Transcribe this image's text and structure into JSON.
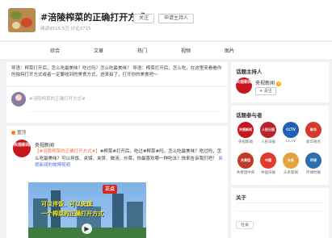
{
  "header": {
    "title": "#涪陵榨菜的正确打开方式#",
    "follow_button": "关注",
    "host_apply_button": "申请主持人",
    "stats": "阅读9515.5万  讨论3715"
  },
  "tabs": [
    {
      "label": "综合"
    },
    {
      "label": "文章"
    },
    {
      "label": "热门"
    },
    {
      "label": "视频"
    },
    {
      "label": "图片"
    }
  ],
  "intro": {
    "text": "导语：榨菜打开后，怎么吃最美味？吃过吗？怎么吃最美味？   导语：榨菜打开后，怎么吃，在这里来看看你的独特打开方式或者一定要收到的美食方式，进来拍了，打开你的美食吧～"
  },
  "composer": {
    "placeholder": "#涪陵榨菜的正确打开方式#"
  },
  "feed": {
    "label": "置顶",
    "post": {
      "author": "央视新闻",
      "avatar_text": "央视新闻",
      "text_tag": "【#涪陵榨菜的正确打开方式#】",
      "text_body": "#榨菜#打开后，吃过#榨菜#吗，怎么吃最美味？吃过吗，怎么吃最美味？可以拌饭、夹馍、夹饼、做汤、炒菜，你最喜欢哪一种吃法？快来告诉我们吧！",
      "text_more": "央视新闻的微博视频",
      "image_logo": "正点",
      "image_caption_1": "可以拌饭、可以夹馍",
      "image_caption_2": "一个榨菜的正确打开方式",
      "play_icon": "▶"
    }
  },
  "side": {
    "host_title": "话题主持人",
    "host_name": "央视新闻",
    "host_avatar_text": "央视新闻",
    "host_follow": "+ 关注",
    "participants_title": "话题参与者",
    "participants": [
      {
        "avatar_text": "央视新闻",
        "color": "#c8161d",
        "name": "央视新闻"
      },
      {
        "avatar_text": "人民日报",
        "color": "#b8232a",
        "name": "人民日报"
      },
      {
        "avatar_text": "CCTV",
        "color": "#1f5fb4",
        "name": "CCTV"
      },
      {
        "avatar_text": "新华",
        "color": "#d23a2a",
        "name": "新华视点"
      },
      {
        "avatar_text": "共青团",
        "color": "#c0392b",
        "name": "共青团中央"
      },
      {
        "avatar_text": "中国",
        "color": "#e03b2c",
        "name": "中国日报"
      },
      {
        "avatar_text": "头条",
        "color": "#e6a23c",
        "name": "头条新闻"
      },
      {
        "avatar_text": "环球",
        "color": "#2a6fb0",
        "name": "环球时报"
      }
    ],
    "about_title": "关于",
    "about_chip": "社会"
  }
}
